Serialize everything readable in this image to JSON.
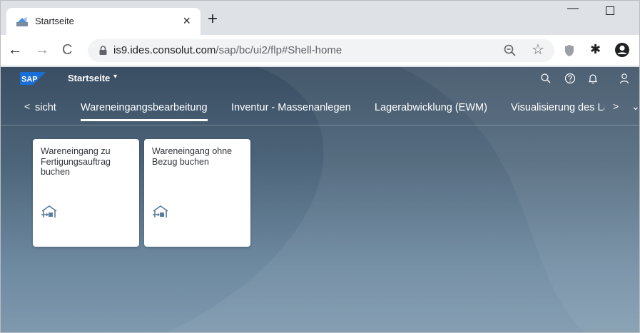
{
  "browser": {
    "tab": {
      "title": "Startseite",
      "close_label": "×"
    },
    "new_tab_label": "+",
    "window": {
      "minimize_label": "—"
    },
    "address": {
      "host": "is9.ides.consolut.com",
      "path": "/sap/bc/ui2/flp#Shell-home"
    },
    "nav": {
      "back": "←",
      "forward": "→",
      "reload": "C"
    },
    "star_label": "☆",
    "puzzle_label": "✱"
  },
  "shell": {
    "logo_text": "SAP",
    "title": "Startseite",
    "caret": "▾"
  },
  "anchor_bar": {
    "prev": "<",
    "next": ">",
    "more": "⌄",
    "items": [
      {
        "label": "sicht",
        "selected": false
      },
      {
        "label": "Wareneingangsbearbeitung",
        "selected": true
      },
      {
        "label": "Inventur - Massenanlegen",
        "selected": false
      },
      {
        "label": "Lagerabwicklung (EWM)",
        "selected": false
      },
      {
        "label": "Visualisierung des Lagers",
        "selected": false
      }
    ]
  },
  "tiles": [
    {
      "title": "Wareneingang zu Fertigungsauftrag buchen",
      "icon": "goods-receipt-icon"
    },
    {
      "title": "Wareneingang ohne Bezug buchen",
      "icon": "goods-receipt-icon"
    }
  ],
  "colors": {
    "shell_background": "#3a4e63",
    "tile_background": "#ffffff",
    "tile_icon": "#5a7da0",
    "sap_logo": "#1a6ed8"
  }
}
